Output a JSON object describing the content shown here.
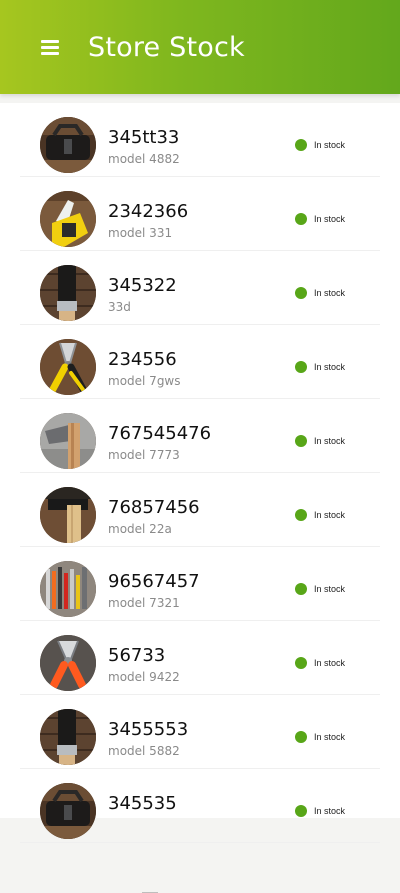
{
  "app_bar": {
    "title": "Store Stock",
    "menu_icon": "hamburger-menu-icon",
    "gradient_start": "#a6c61f",
    "gradient_end": "#63a81c"
  },
  "status_color": "#58a618",
  "items": [
    {
      "name": "345tt33",
      "subtitle": "model 4882",
      "status": "In stock",
      "thumbnail": "tool-bag-photo"
    },
    {
      "name": "2342366",
      "subtitle": "model 331",
      "status": "In stock",
      "thumbnail": "utility-knife-photo"
    },
    {
      "name": "345322",
      "subtitle": "33d",
      "status": "In stock",
      "thumbnail": "paint-brush-photo"
    },
    {
      "name": "234556",
      "subtitle": "model 7gws",
      "status": "In stock",
      "thumbnail": "pliers-photo"
    },
    {
      "name": "767545476",
      "subtitle": "model 7773",
      "status": "In stock",
      "thumbnail": "hammer-photo"
    },
    {
      "name": "76857456",
      "subtitle": "model 22a",
      "status": "In stock",
      "thumbnail": "hammer-handle-photo"
    },
    {
      "name": "96567457",
      "subtitle": "model 7321",
      "status": "In stock",
      "thumbnail": "tool-set-photo"
    },
    {
      "name": "56733",
      "subtitle": "model 9422",
      "status": "In stock",
      "thumbnail": "wire-cutters-photo"
    },
    {
      "name": "3455553",
      "subtitle": "model 5882",
      "status": "In stock",
      "thumbnail": "paint-brush-photo"
    },
    {
      "name": "345535",
      "subtitle": "",
      "status": "In stock",
      "thumbnail": "tool-bag-photo"
    }
  ]
}
